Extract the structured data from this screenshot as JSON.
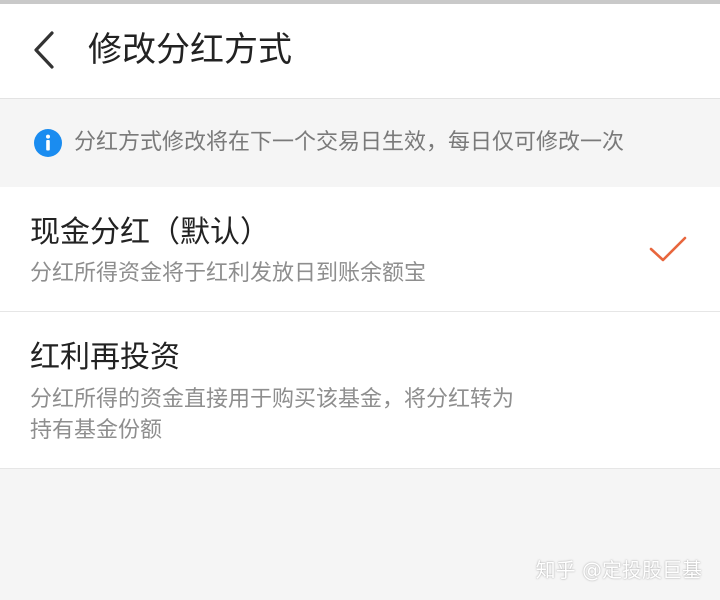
{
  "header": {
    "back_icon": "chevron-left-icon",
    "title": "修改分红方式"
  },
  "notice": {
    "icon": "info-icon",
    "text": "分红方式修改将在下一个交易日生效，每日仅可修改一次",
    "icon_color": "#1a8cf0"
  },
  "options": [
    {
      "title": "现金分红（默认）",
      "description": "分红所得资金将于红利发放日到账余额宝",
      "selected": true
    },
    {
      "title": "红利再投资",
      "description_lines": [
        "分红所得的资金直接用于购买该基金，将分红转为",
        "持有基金份额"
      ],
      "selected": false
    }
  ],
  "check_color": "#e8663d",
  "watermark": "知乎 @定投股巨基"
}
